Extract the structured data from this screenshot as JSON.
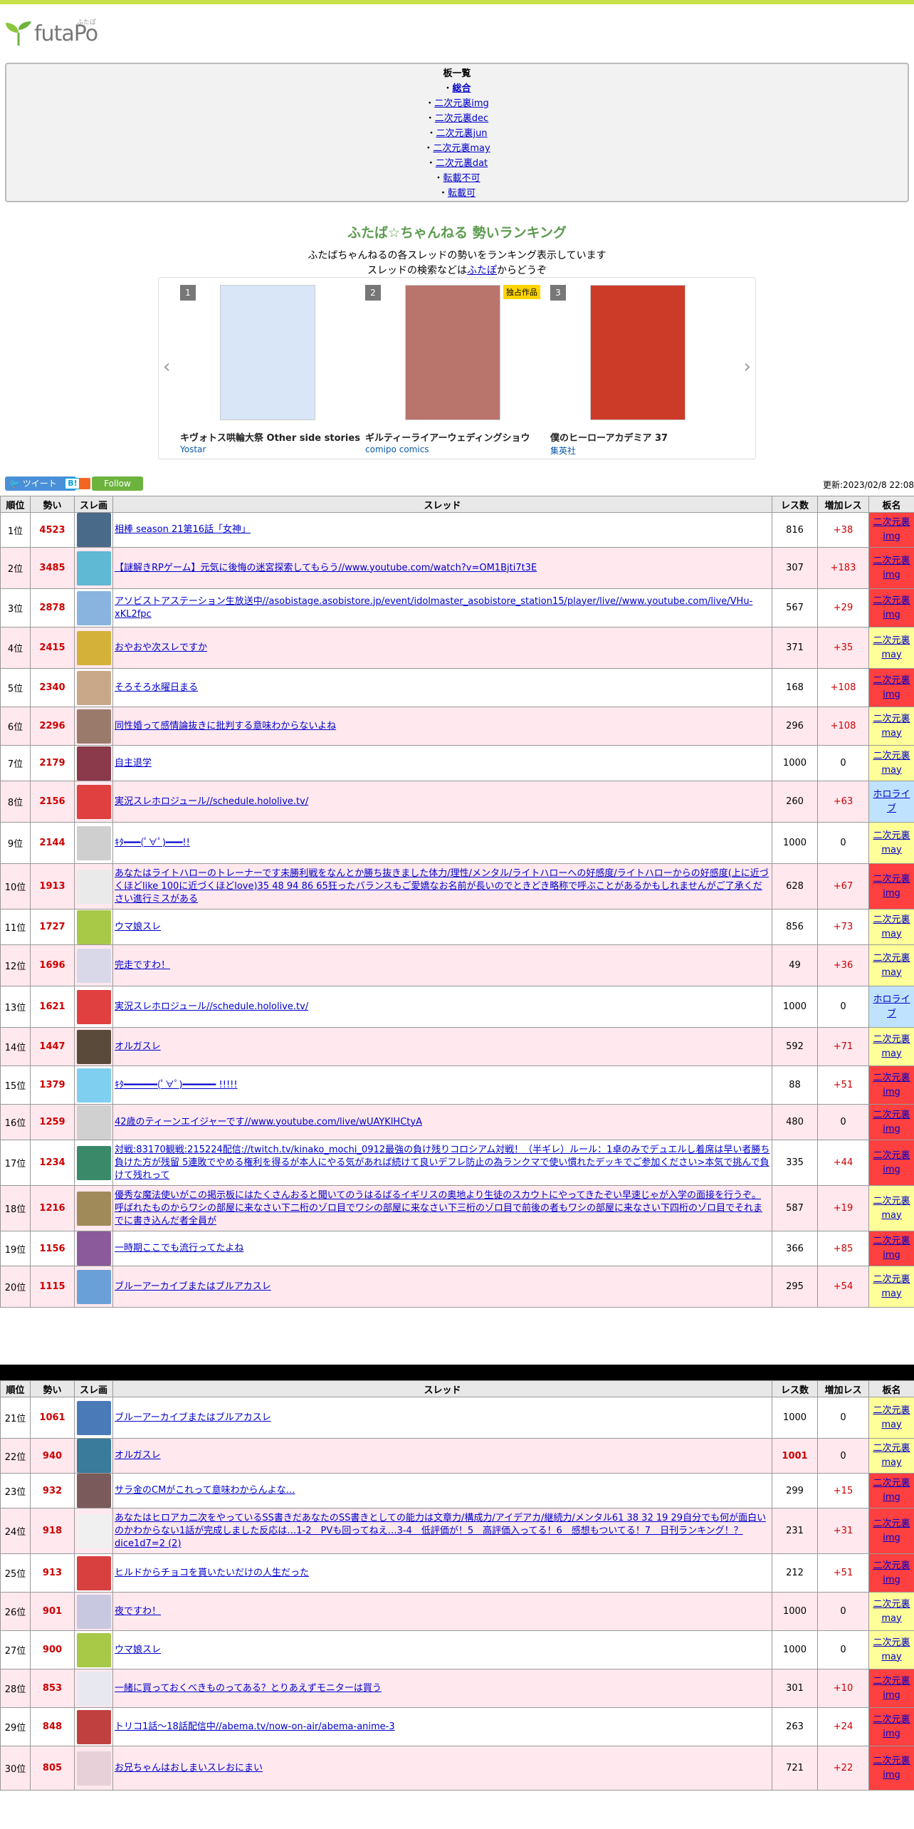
{
  "logo": {
    "text": "futaPo",
    "kana": "ふたぽ"
  },
  "boards": {
    "title": "板一覧",
    "items": [
      "総合",
      "二次元裏img",
      "二次元裏dec",
      "二次元裏jun",
      "二次元裏may",
      "二次元裏dat",
      "転載不可",
      "転載可"
    ]
  },
  "ranking": {
    "title": "ふたば☆ちゃんねる 勢いランキング",
    "desc1": "ふたばちゃんねるの各スレッドの勢いをランキング表示しています",
    "desc2_pre": "スレッドの検索などは",
    "desc2_link": "ふたぽ",
    "desc2_post": "からどうぞ"
  },
  "carousel": [
    {
      "num": "1",
      "title": "キヴォトス哄輪大祭 Other side stories",
      "publisher": "Yostar",
      "badge": "",
      "color": "#d9e6f7"
    },
    {
      "num": "2",
      "title": "ギルティーライアーウェディングショウ",
      "publisher": "comipo comics",
      "badge": "独占作品",
      "color": "#b9746c"
    },
    {
      "num": "3",
      "title": "僕のヒーローアカデミア 37",
      "publisher": "集英社",
      "badge": "",
      "color": "#cc3a28"
    }
  ],
  "share": {
    "tweet": "ツイート",
    "hatena": "B!",
    "follow": "Follow"
  },
  "updated": "更新:2023/02/8 22:08",
  "headers": {
    "rank": "順位",
    "ikioi": "勢い",
    "thumb": "スレ画",
    "thread": "スレッド",
    "res": "レス数",
    "add": "増加レス",
    "board": "板名"
  },
  "rows1": [
    {
      "rank": "1位",
      "ikioi": "4523",
      "title": "相棒 season 21第16話「女神」",
      "res": "816",
      "add": "+38",
      "board": "二次元裏img",
      "bt": "img",
      "thumb": "#4a6a8a"
    },
    {
      "rank": "2位",
      "ikioi": "3485",
      "title": "【謎解きRPゲーム】元気に後悔の迷宮探索してもらう//www.youtube.com/watch?v=OM1Bjti7t3E",
      "res": "307",
      "add": "+183",
      "board": "二次元裏img",
      "bt": "img",
      "thumb": "#5fb8d4"
    },
    {
      "rank": "3位",
      "ikioi": "2878",
      "title": "アソビストアステーション生放送中//asobistage.asobistore.jp/event/idolmaster_asobistore_station15/player/live//www.youtube.com/live/VHu-xKL2fpc",
      "res": "567",
      "add": "+29",
      "board": "二次元裏img",
      "bt": "img",
      "thumb": "#8ab4e0"
    },
    {
      "rank": "4位",
      "ikioi": "2415",
      "title": "おやおや次スレですか",
      "res": "371",
      "add": "+35",
      "board": "二次元裏may",
      "bt": "may",
      "thumb": "#d4b23a"
    },
    {
      "rank": "5位",
      "ikioi": "2340",
      "title": "そろそろ水曜日まる",
      "res": "168",
      "add": "+108",
      "board": "二次元裏img",
      "bt": "img",
      "thumb": "#c9a88a"
    },
    {
      "rank": "6位",
      "ikioi": "2296",
      "title": "同性婚って感情論抜きに批判する意味わからないよね",
      "res": "296",
      "add": "+108",
      "board": "二次元裏may",
      "bt": "may",
      "thumb": "#9a7a6a"
    },
    {
      "rank": "7位",
      "ikioi": "2179",
      "title": "自主退学",
      "res": "1000",
      "add": "0",
      "board": "二次元裏may",
      "bt": "may",
      "thumb": "#8a3a4a"
    },
    {
      "rank": "8位",
      "ikioi": "2156",
      "title": "実況スレホロジュール//schedule.hololive.tv/",
      "res": "260",
      "add": "+63",
      "board": "ホロライブ",
      "bt": "holo",
      "thumb": "#e04040"
    },
    {
      "rank": "9位",
      "ikioi": "2144",
      "title": "ｷﾀ━━━(ﾟ∀ﾟ)━━━!!",
      "res": "1000",
      "add": "0",
      "board": "二次元裏may",
      "bt": "may",
      "thumb": "#cfcfcf"
    },
    {
      "rank": "10位",
      "ikioi": "1913",
      "title": "あなたはライトハローのトレーナーです未勝利戦をなんとか勝ち抜きました体力/理性/メンタル/ライトハローへの好感度/ライトハローからの好感度(上に近づくほどlike 100に近づくほどlove)35 48 94 86 65狂ったバランスもご愛嬌なお名前が長いのでときどき略称で呼ぶことがあるかもしれませんがご了承ください進行ミスがある",
      "res": "628",
      "add": "+67",
      "board": "二次元裏img",
      "bt": "img",
      "thumb": "#eaeaea"
    },
    {
      "rank": "11位",
      "ikioi": "1727",
      "title": "ウマ娘スレ",
      "res": "856",
      "add": "+73",
      "board": "二次元裏may",
      "bt": "may",
      "thumb": "#a8c848"
    },
    {
      "rank": "12位",
      "ikioi": "1696",
      "title": "完走ですわ！",
      "res": "49",
      "add": "+36",
      "board": "二次元裏may",
      "bt": "may",
      "thumb": "#d8d8e8"
    },
    {
      "rank": "13位",
      "ikioi": "1621",
      "title": "実況スレホロジュール//schedule.hololive.tv/",
      "res": "1000",
      "add": "0",
      "board": "ホロライブ",
      "bt": "holo",
      "thumb": "#e04040"
    },
    {
      "rank": "14位",
      "ikioi": "1447",
      "title": "オルガスレ",
      "res": "592",
      "add": "+71",
      "board": "二次元裏may",
      "bt": "may",
      "thumb": "#5a4a3a"
    },
    {
      "rank": "15位",
      "ikioi": "1379",
      "title": "ｷﾀ━━━━━━(ﾟ∀ﾟ)━━━━━━ !!!!!",
      "res": "88",
      "add": "+51",
      "board": "二次元裏img",
      "bt": "img",
      "thumb": "#7fd0f0"
    },
    {
      "rank": "16位",
      "ikioi": "1259",
      "title": "42歳のティーンエイジャーです//www.youtube.com/live/wUAYKlHCtyA",
      "res": "480",
      "add": "0",
      "board": "二次元裏img",
      "bt": "img",
      "thumb": "#d0d0d0"
    },
    {
      "rank": "17位",
      "ikioi": "1234",
      "title": "対戦:83170観戦:215224配信://twitch.tv/kinako_mochi_0912最強の負け残りコロシアム対戦！（半ギレ）ルール：1卓のみでデュエルし着席は早い者勝ち 負けた方が残留 5連敗でやめる権利を得るが本人にやる気があれば続けて良いデフレ防止の為ランクマで使い慣れたデッキでご参加ください>本気で挑んで負けて残れって",
      "res": "335",
      "add": "+44",
      "board": "二次元裏img",
      "bt": "img",
      "thumb": "#3a8a6a"
    },
    {
      "rank": "18位",
      "ikioi": "1216",
      "title": "優秀な魔法使いがこの掲示板にはたくさんおると聞いてのうはるばるイギリスの奥地より生徒のスカウトにやってきたぞい早速じゃが入学の面接を行うぞ。呼ばれたものからワシの部屋に来なさい下二桁のゾロ目でワシの部屋に来なさい下三桁のゾロ目で前後の者もワシの部屋に来なさい下四桁のゾロ目でそれまでに書き込んだ者全員が",
      "res": "587",
      "add": "+19",
      "board": "二次元裏may",
      "bt": "may",
      "thumb": "#a08a5a"
    },
    {
      "rank": "19位",
      "ikioi": "1156",
      "title": "一時期ここでも流行ってたよね",
      "res": "366",
      "add": "+85",
      "board": "二次元裏img",
      "bt": "img",
      "thumb": "#8a5a9a"
    },
    {
      "rank": "20位",
      "ikioi": "1115",
      "title": "ブルーアーカイブまたはブルアカスレ",
      "res": "295",
      "add": "+54",
      "board": "二次元裏may",
      "bt": "may",
      "thumb": "#6aa0d8"
    }
  ],
  "rows2": [
    {
      "rank": "21位",
      "ikioi": "1061",
      "title": "ブルーアーカイブまたはブルアカスレ",
      "res": "1000",
      "add": "0",
      "board": "二次元裏may",
      "bt": "may",
      "thumb": "#4a7ab8"
    },
    {
      "rank": "22位",
      "ikioi": "940",
      "title": "オルガスレ",
      "res": "1001",
      "add": "0",
      "board": "二次元裏may",
      "bt": "may",
      "thumb": "#3a7a9a"
    },
    {
      "rank": "23位",
      "ikioi": "932",
      "title": "サラ金のCMがこれって意味わからんよな…",
      "res": "299",
      "add": "+15",
      "board": "二次元裏img",
      "bt": "img",
      "thumb": "#7a5a5a"
    },
    {
      "rank": "24位",
      "ikioi": "918",
      "title": "あなたはヒロアカ二次をやっているSS書きだあなたのSS書きとしての能力は文章力/構成力/アイデアカ/継続力/メンタル61 38 32 19 29自分でも何が面白いのかわからない1話が完成しました反応は…1-2　PVも回ってねえ…3-4　低評価が！5　高評価入ってる！6　感想もついてる！7　日刊ランキング！？dice1d7=2 (2)",
      "res": "231",
      "add": "+31",
      "board": "二次元裏img",
      "bt": "img",
      "thumb": "#f0f0f0"
    },
    {
      "rank": "25位",
      "ikioi": "913",
      "title": "ヒルドからチョコを貰いたいだけの人生だった",
      "res": "212",
      "add": "+51",
      "board": "二次元裏img",
      "bt": "img",
      "thumb": "#d84040"
    },
    {
      "rank": "26位",
      "ikioi": "901",
      "title": "夜ですわ！",
      "res": "1000",
      "add": "0",
      "board": "二次元裏may",
      "bt": "may",
      "thumb": "#c8c8e0"
    },
    {
      "rank": "27位",
      "ikioi": "900",
      "title": "ウマ娘スレ",
      "res": "1000",
      "add": "0",
      "board": "二次元裏may",
      "bt": "may",
      "thumb": "#a8c848"
    },
    {
      "rank": "28位",
      "ikioi": "853",
      "title": "一緒に買っておくべきものってある？とりあえずモニターは買う",
      "res": "301",
      "add": "+10",
      "board": "二次元裏img",
      "bt": "img",
      "thumb": "#e8e8f0"
    },
    {
      "rank": "29位",
      "ikioi": "848",
      "title": "トリコ1話〜18話配信中//abema.tv/now-on-air/abema-anime-3",
      "res": "263",
      "add": "+24",
      "board": "二次元裏img",
      "bt": "img",
      "thumb": "#c04040"
    },
    {
      "rank": "30位",
      "ikioi": "805",
      "title": "お兄ちゃんはおしまいスレおにまい",
      "res": "721",
      "add": "+22",
      "board": "二次元裏img",
      "bt": "img",
      "thumb": "#e8d0d8"
    }
  ]
}
